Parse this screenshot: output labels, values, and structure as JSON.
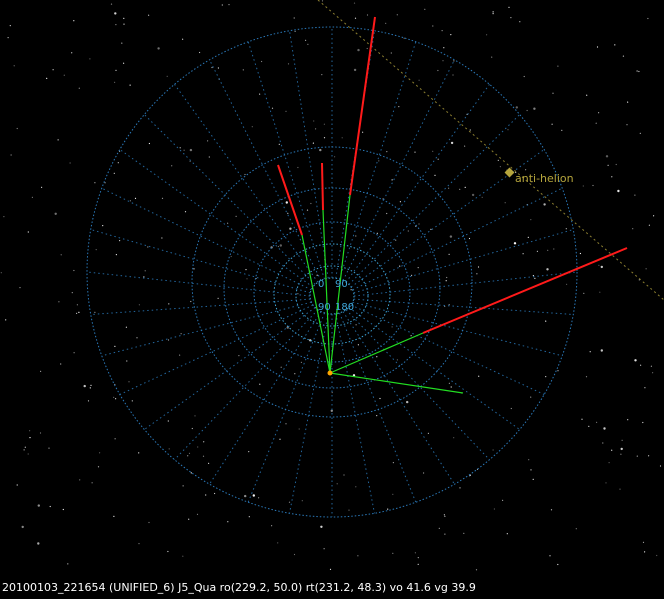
{
  "status": {
    "text": "20100103_221654 (UNIFIED_6) J5_Qua ro(229.2, 50.0) rt(231.2, 48.3) vo 41.6 vg 39.9"
  },
  "markers": {
    "anti_helion": "anti-helion"
  },
  "grid_labels": {
    "zero": "0",
    "ninety_top": "90",
    "ninety_left": "90",
    "hundred": "180"
  },
  "colors": {
    "background": "#000000",
    "grid": "#2a78b8",
    "inner_grid": "#3fa6d8",
    "observed_trajectory": "#ff1a1a",
    "computed_trajectory": "#22dd22",
    "anti_helion": "#b5a53c",
    "radiant": "#ffa500",
    "stars": "#ffffff"
  }
}
